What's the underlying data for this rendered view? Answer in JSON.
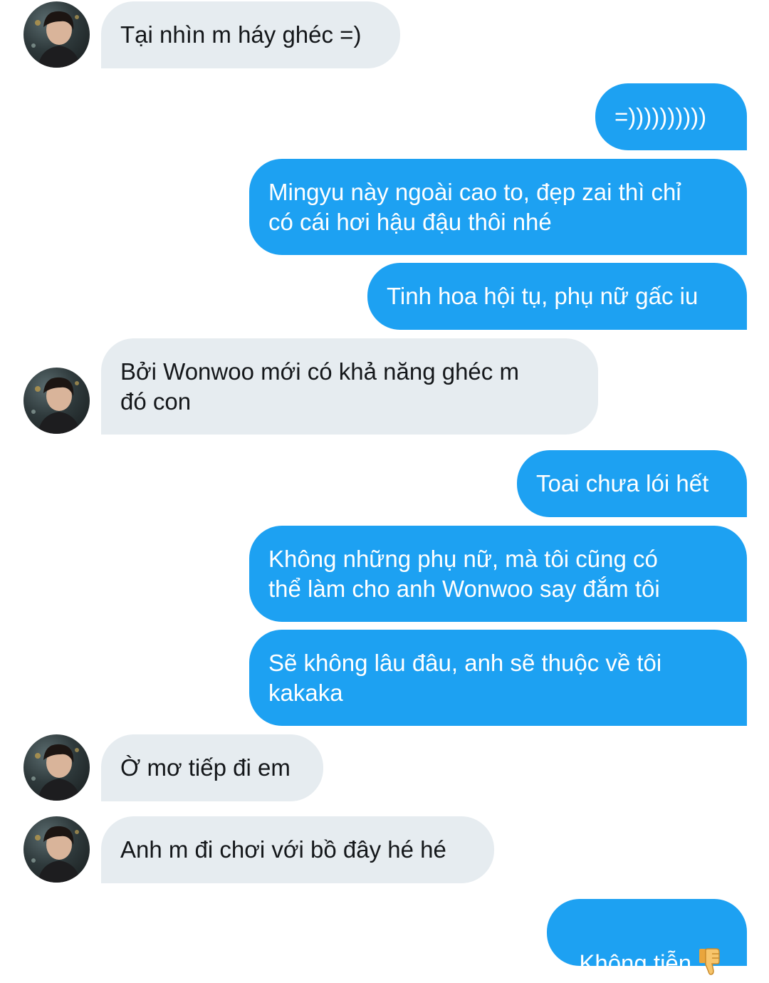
{
  "conversation": {
    "messages": [
      {
        "id": "m1",
        "side": "incoming",
        "text": "Tại nhìn m háy ghéc =)"
      },
      {
        "id": "m2",
        "side": "outgoing",
        "text": "=))))))))))"
      },
      {
        "id": "m3",
        "side": "outgoing",
        "text": "Mingyu này ngoài cao to, đẹp zai thì chỉ\ncó cái hơi hậu đậu thôi nhé"
      },
      {
        "id": "m4",
        "side": "outgoing",
        "text": "Tinh hoa hội tụ, phụ nữ gấc iu"
      },
      {
        "id": "m5",
        "side": "incoming",
        "text": "Bởi Wonwoo mới có khả năng ghéc m\nđó con"
      },
      {
        "id": "m6",
        "side": "outgoing",
        "text": "Toai chưa lói hết"
      },
      {
        "id": "m7",
        "side": "outgoing",
        "text": "Không những phụ nữ, mà tôi cũng có\nthể làm cho anh Wonwoo say đắm tôi"
      },
      {
        "id": "m8",
        "side": "outgoing",
        "text": "Sẽ không lâu đâu, anh sẽ thuộc về tôi\nkakaka"
      },
      {
        "id": "m9",
        "side": "incoming",
        "text": "Ờ mơ tiếp đi em"
      },
      {
        "id": "m10",
        "side": "incoming",
        "text": "Anh m đi chơi với bồ đây hé hé"
      },
      {
        "id": "m11",
        "side": "outgoing",
        "text": "Không tiễn",
        "emoji": "thumbs-down-icon"
      }
    ]
  },
  "colors": {
    "outgoing_bubble": "#1da1f2",
    "incoming_bubble": "#e6ecf0",
    "incoming_text": "#14171a",
    "outgoing_text": "#ffffff"
  }
}
